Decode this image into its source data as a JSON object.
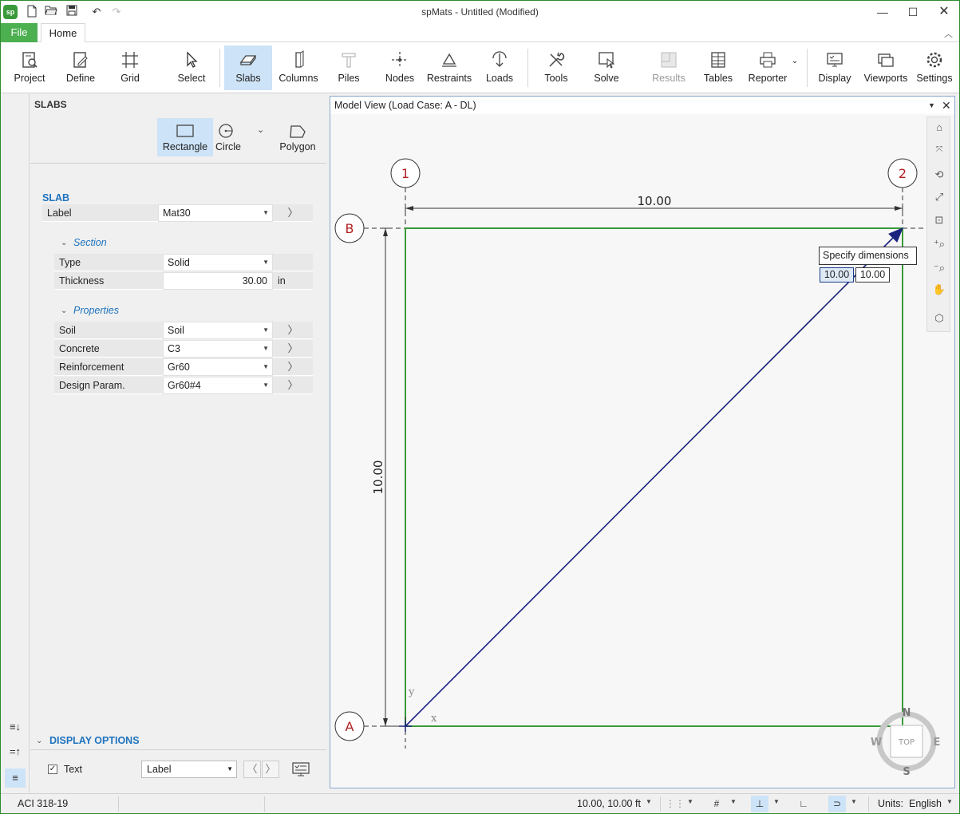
{
  "window": {
    "title": "spMats - Untitled (Modified)",
    "logo_text": "sp"
  },
  "tabs": {
    "file": "File",
    "home": "Home"
  },
  "ribbon": {
    "project": "Project",
    "define": "Define",
    "grid": "Grid",
    "select": "Select",
    "slabs": "Slabs",
    "columns": "Columns",
    "piles": "Piles",
    "nodes": "Nodes",
    "restraints": "Restraints",
    "loads": "Loads",
    "tools": "Tools",
    "solve": "Solve",
    "results": "Results",
    "tables": "Tables",
    "reporter": "Reporter",
    "display": "Display",
    "viewports": "Viewports",
    "settings": "Settings"
  },
  "panel": {
    "title": "SLABS",
    "shapes": {
      "rectangle": "Rectangle",
      "circle": "Circle",
      "polygon": "Polygon"
    },
    "slab_head": "SLAB",
    "label": {
      "name": "Label",
      "value": "Mat30"
    },
    "section_head": "Section",
    "type": {
      "name": "Type",
      "value": "Solid"
    },
    "thickness": {
      "name": "Thickness",
      "value": "30.00",
      "unit": "in"
    },
    "properties_head": "Properties",
    "soil": {
      "name": "Soil",
      "value": "Soil"
    },
    "concrete": {
      "name": "Concrete",
      "value": "C3"
    },
    "reinforcement": {
      "name": "Reinforcement",
      "value": "Gr60"
    },
    "design_param": {
      "name": "Design Param.",
      "value": "Gr60#4"
    },
    "display_options": "DISPLAY OPTIONS",
    "text_option": "Text",
    "text_select": "Label"
  },
  "model_view": {
    "title": "Model View (Load Case: A - DL)",
    "grid_x": [
      "1",
      "2"
    ],
    "grid_y": [
      "B",
      "A"
    ],
    "dim_horizontal": "10.00",
    "dim_vertical": "10.00",
    "axis_x": "x",
    "axis_y": "y",
    "tooltip": "Specify dimensions",
    "input_1": "10.00",
    "input_2": "10.00",
    "compass": {
      "n": "N",
      "s": "S",
      "e": "E",
      "w": "W",
      "top": "TOP"
    }
  },
  "status": {
    "code": "ACI 318-19",
    "coords": "10.00, 10.00 ft",
    "units_label": "Units:",
    "units_value": "English"
  },
  "colors": {
    "accent": "#4caf50",
    "slab_outline": "#3a9a3a",
    "grid_label": "#b22222",
    "selection": "#cde3f7",
    "rubber_band": "#1a237e"
  }
}
